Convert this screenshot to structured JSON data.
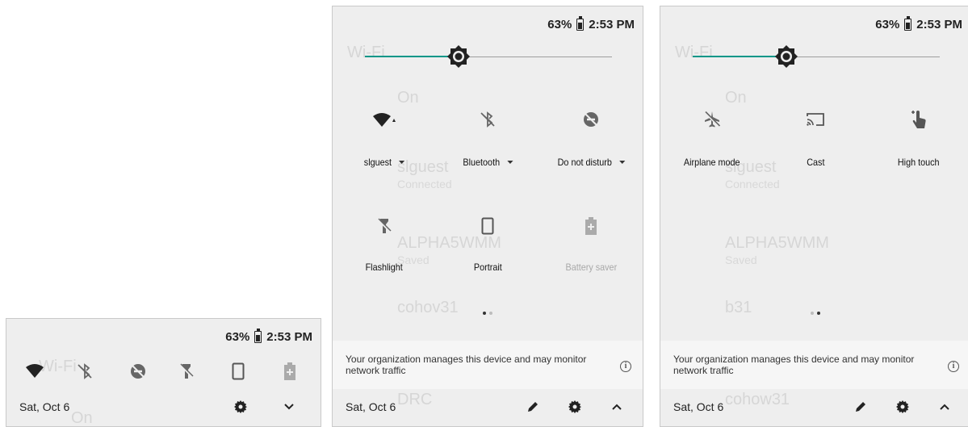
{
  "status": {
    "battery": "63%",
    "time": "2:53 PM"
  },
  "background_list": {
    "header": "Wi-Fi",
    "toggle": "On",
    "networks": [
      {
        "ssid": "slguest",
        "state": "Connected"
      },
      {
        "ssid": "ALPHA5WMM",
        "state": "Saved"
      },
      {
        "ssid": "cohov31",
        "state": ""
      },
      {
        "ssid": "b31",
        "state": ""
      },
      {
        "ssid": "DRC",
        "state": ""
      },
      {
        "ssid": "cohow31",
        "state": ""
      }
    ]
  },
  "page1_tiles": [
    {
      "label": "slguest",
      "icon": "wifi-icon",
      "dropdown": true
    },
    {
      "label": "Bluetooth",
      "icon": "bluetooth-off-icon",
      "dropdown": true
    },
    {
      "label": "Do not disturb",
      "icon": "do-not-disturb-off-icon",
      "dropdown": true
    },
    {
      "label": "Flashlight",
      "icon": "flashlight-off-icon",
      "dropdown": false
    },
    {
      "label": "Portrait",
      "icon": "portrait-icon",
      "dropdown": false
    },
    {
      "label": "Battery saver",
      "icon": "battery-saver-icon",
      "dropdown": false,
      "disabled": true
    }
  ],
  "page2_tiles": [
    {
      "label": "Airplane mode",
      "icon": "airplane-off-icon"
    },
    {
      "label": "Cast",
      "icon": "cast-icon"
    },
    {
      "label": "High touch",
      "icon": "high-touch-icon"
    }
  ],
  "notice": {
    "text": "Your organization manages this device and may monitor network traffic"
  },
  "footer": {
    "date": "Sat, Oct 6"
  },
  "brightness_level": 0.38,
  "colors": {
    "accent": "#009688",
    "background": "#eeeeee"
  }
}
